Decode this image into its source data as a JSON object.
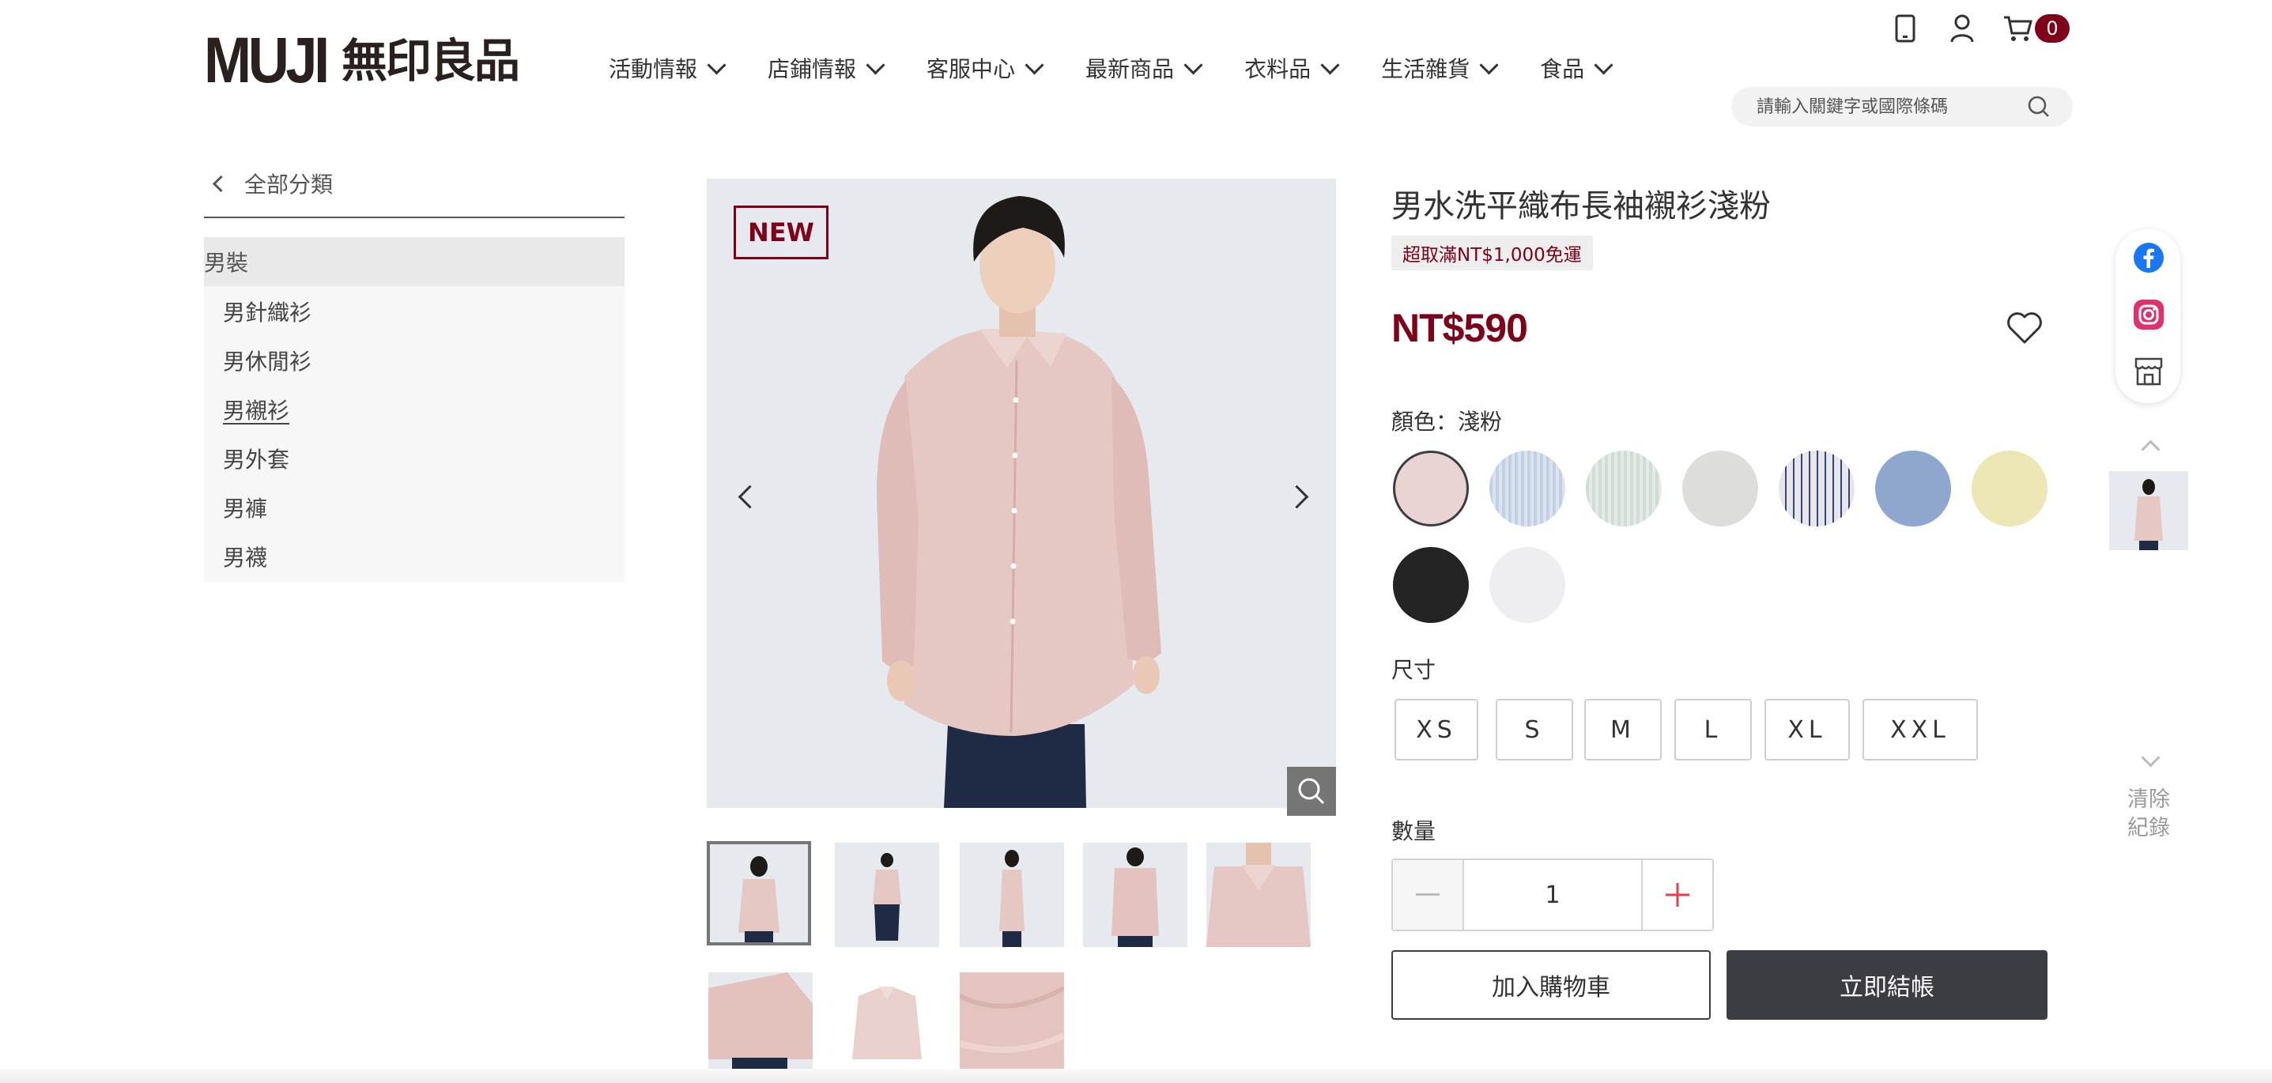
{
  "header": {
    "logo_en": "MUJI",
    "logo_jp": "無印良品",
    "nav": [
      {
        "label": "活動情報"
      },
      {
        "label": "店鋪情報"
      },
      {
        "label": "客服中心"
      },
      {
        "label": "最新商品"
      },
      {
        "label": "衣料品"
      },
      {
        "label": "生活雜貨"
      },
      {
        "label": "食品"
      }
    ],
    "cart_count": "0",
    "search_placeholder": "請輸入關鍵字或國際條碼",
    "icons": [
      "mobile-icon",
      "user-icon",
      "cart-icon",
      "search-icon",
      "chevron-down-icon"
    ]
  },
  "sidebar": {
    "back_label": "全部分類",
    "category": "男裝",
    "items": [
      {
        "label": "男針織衫"
      },
      {
        "label": "男休閒衫"
      },
      {
        "label": "男襯衫"
      },
      {
        "label": "男外套"
      },
      {
        "label": "男褲"
      },
      {
        "label": "男襪"
      }
    ],
    "active_item": "男襯衫"
  },
  "gallery": {
    "badge": "NEW",
    "thumbnail_count": 8,
    "selected_thumbnail": 1,
    "icons": [
      "chevron-left-icon",
      "chevron-right-icon",
      "zoom-icon"
    ]
  },
  "product": {
    "title": "男水洗平織布長袖襯衫淺粉",
    "shipping_tag": "超取滿NT$1,000免運",
    "price": "NT$590",
    "color_label": "顏色：淺粉",
    "colors": [
      {
        "name": "淺粉",
        "hex": "#ead4d3",
        "selected": true
      },
      {
        "name": "淺藍條紋",
        "hex": "#c3d0e4"
      },
      {
        "name": "淺綠條紋",
        "hex": "#d7e1dc"
      },
      {
        "name": "淺灰",
        "hex": "#dddddc"
      },
      {
        "name": "深藍條紋",
        "hex": "#d9dde6"
      },
      {
        "name": "藍色",
        "hex": "#8fa6cf"
      },
      {
        "name": "淺黃",
        "hex": "#ede7b6"
      },
      {
        "name": "黑色",
        "hex": "#242424"
      },
      {
        "name": "白色",
        "hex": "#eeeef1"
      }
    ],
    "size_label": "尺寸",
    "sizes": [
      "XS",
      "S",
      "M",
      "L",
      "XL",
      "XXL"
    ],
    "qty_label": "數量",
    "qty": "1",
    "add_to_cart": "加入購物車",
    "buy_now": "立即結帳"
  },
  "float": {
    "icons": [
      "facebook-icon",
      "instagram-icon",
      "store-icon",
      "chevron-up-icon",
      "chevron-down-icon"
    ],
    "clear_label_1": "清除",
    "clear_label_2": "紀錄"
  },
  "colors": {
    "brand": "#7f0019",
    "dark": "#3c3c43",
    "facebook": "#1877f2",
    "instagram": "#e1306c"
  }
}
